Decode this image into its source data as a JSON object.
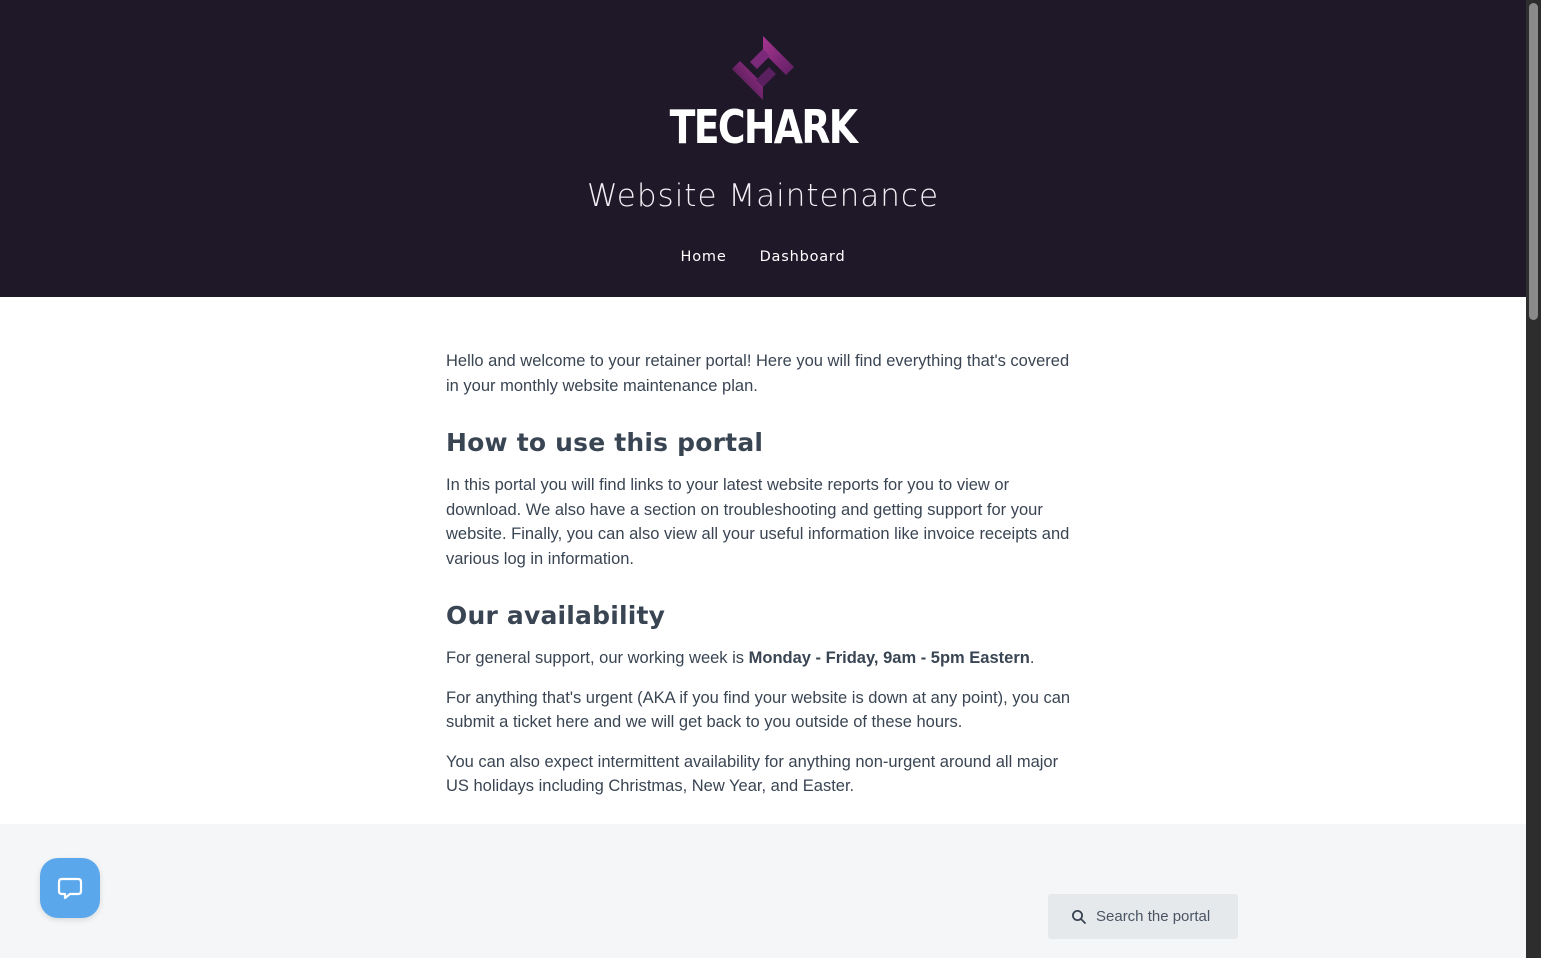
{
  "header": {
    "logo_text": "TECHARK",
    "site_title": "Website Maintenance",
    "nav": [
      {
        "label": "Home"
      },
      {
        "label": "Dashboard"
      }
    ],
    "background": "#1f1828",
    "logo_accent": "#8b2a7e"
  },
  "content": {
    "intro": "Hello and welcome to your retainer portal! Here you will find everything that's covered in your monthly website maintenance plan.",
    "sections": [
      {
        "heading": "How to use this portal",
        "body": "In this portal you will find links to your latest website reports for you to view or download. We also have a section on troubleshooting and getting support for your website. Finally, you can also view all your useful information like invoice receipts and various log in information."
      },
      {
        "heading": "Our availability",
        "general_prefix": "For general support, our working week is ",
        "general_hours": "Monday - Friday, 9am - 5pm Eastern",
        "general_suffix": ".",
        "urgent": "For anything that's urgent (AKA if you find your website is down at any point), you can submit a ticket here and we will get back to you outside of these hours.",
        "holidays": "You can also expect intermittent availability for anything non-urgent around all major US holidays including Christmas, New Year, and Easter."
      }
    ]
  },
  "search": {
    "placeholder": "Search the portal",
    "icon": "search-icon"
  },
  "help_widget": {
    "icon": "chat-bubble-icon",
    "color": "#5aa7ec"
  }
}
